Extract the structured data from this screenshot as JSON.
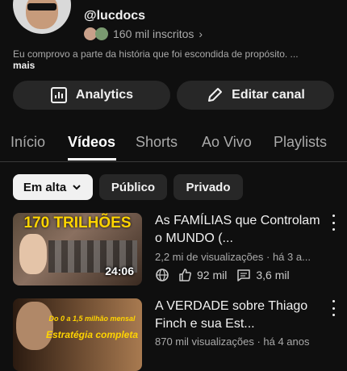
{
  "channel": {
    "handle": "@lucdocs",
    "subscribers": "160 mil inscritos",
    "description": "Eu comprovo a parte da história que foi escondida de propósito. ...",
    "description_more": "mais"
  },
  "actions": {
    "analytics_label": "Analytics",
    "edit_label": "Editar canal"
  },
  "tabs": [
    {
      "label": "Início"
    },
    {
      "label": "Vídeos"
    },
    {
      "label": "Shorts"
    },
    {
      "label": "Ao Vivo"
    },
    {
      "label": "Playlists"
    }
  ],
  "active_tab": "Vídeos",
  "filters": {
    "sort_label": "Em alta",
    "public_label": "Público",
    "private_label": "Privado"
  },
  "videos": [
    {
      "thumb_text": "170 TRILHÕES",
      "duration": "24:06",
      "title": "As FAMÍLIAS que Controlam o MUNDO (...",
      "meta": "2,2 mi de visualizações · há 3 a...",
      "likes": "92 mil",
      "comments": "3,6 mil"
    },
    {
      "thumb_text_top": "Do 0 a 1,5 milhão mensal",
      "thumb_text": "Estratégia completa",
      "title": "A VERDADE sobre Thiago Finch e sua Est...",
      "meta": "870 mil visualizações · há 4 anos"
    }
  ],
  "colors": {
    "background": "#0f0f0f",
    "surface": "#272727",
    "text": "#f1f1f1",
    "muted": "#aaaaaa",
    "thumb_yellow": "#ffd400"
  }
}
